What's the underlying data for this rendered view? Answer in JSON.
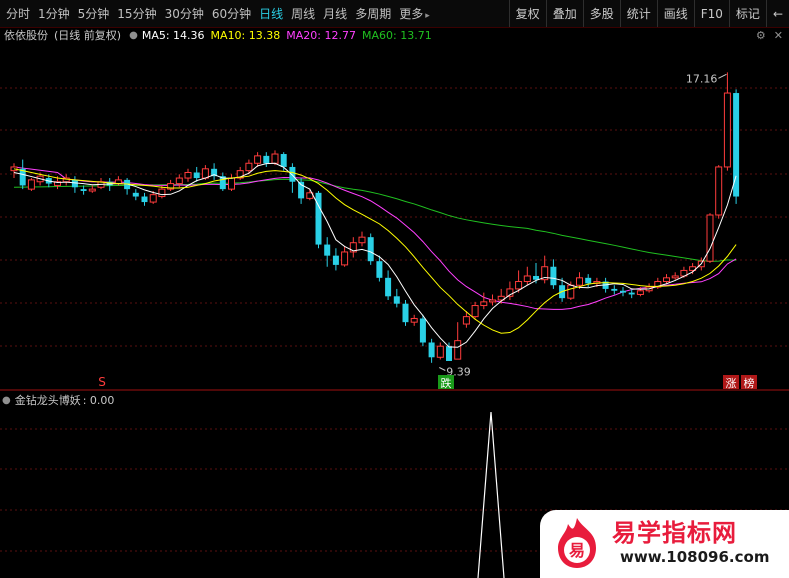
{
  "toolbar": {
    "periods": [
      "分时",
      "1分钟",
      "5分钟",
      "15分钟",
      "30分钟",
      "60分钟",
      "日线",
      "周线",
      "月线",
      "多周期",
      "更多"
    ],
    "active_period": 6,
    "more_arrow": "▸",
    "tools": [
      "复权",
      "叠加",
      "多股",
      "统计",
      "画线",
      "F10",
      "标记",
      "←"
    ]
  },
  "info": {
    "stock": "依依股份",
    "mode": "(日线 前复权)",
    "ma5": "MA5: 14.36",
    "ma10": "MA10: 13.38",
    "ma20": "MA20: 12.77",
    "ma60": "MA60: 13.71",
    "colors": {
      "ma5": "#ffffff",
      "ma10": "#ffff00",
      "ma20": "#ff40ff",
      "ma60": "#20c020"
    }
  },
  "window_icons": [
    "settings-icon",
    "close-icon"
  ],
  "indicator": {
    "name": "金钻龙头博妖",
    "value": ": 0.00"
  },
  "markers": {
    "s": "S",
    "die": "跌",
    "zhang": "涨",
    "bang": "榜"
  },
  "annotations": {
    "high": "17.16",
    "low": "9.39"
  },
  "logo": {
    "title": "易学指标网",
    "url": "www.108096.com",
    "char": "易"
  },
  "chart_data": {
    "type": "candlestick",
    "ylim": [
      8.7,
      17.9
    ],
    "candles": [
      [
        14.5,
        14.6,
        14.7,
        14.3
      ],
      [
        14.55,
        14.1,
        14.8,
        14.0
      ],
      [
        14.0,
        14.25,
        14.3,
        13.95
      ],
      [
        14.2,
        14.35,
        14.45,
        14.1
      ],
      [
        14.3,
        14.15,
        14.4,
        14.05
      ],
      [
        14.1,
        14.2,
        14.35,
        14.0
      ],
      [
        14.2,
        14.3,
        14.4,
        14.1
      ],
      [
        14.25,
        14.05,
        14.35,
        13.9
      ],
      [
        14.0,
        13.95,
        14.1,
        13.85
      ],
      [
        13.95,
        14.0,
        14.1,
        13.9
      ],
      [
        14.05,
        14.2,
        14.3,
        14.0
      ],
      [
        14.2,
        14.1,
        14.3,
        13.95
      ],
      [
        14.15,
        14.25,
        14.35,
        14.1
      ],
      [
        14.25,
        14.0,
        14.3,
        13.85
      ],
      [
        13.9,
        13.8,
        14.0,
        13.7
      ],
      [
        13.8,
        13.65,
        13.9,
        13.55
      ],
      [
        13.65,
        13.85,
        13.95,
        13.6
      ],
      [
        13.8,
        14.0,
        14.1,
        13.75
      ],
      [
        14.0,
        14.15,
        14.25,
        13.95
      ],
      [
        14.15,
        14.3,
        14.4,
        14.05
      ],
      [
        14.3,
        14.45,
        14.55,
        14.2
      ],
      [
        14.45,
        14.3,
        14.6,
        14.2
      ],
      [
        14.3,
        14.55,
        14.65,
        14.25
      ],
      [
        14.55,
        14.35,
        14.7,
        14.25
      ],
      [
        14.35,
        14.0,
        14.45,
        13.95
      ],
      [
        14.0,
        14.3,
        14.4,
        13.95
      ],
      [
        14.3,
        14.5,
        14.6,
        14.25
      ],
      [
        14.5,
        14.7,
        14.8,
        14.4
      ],
      [
        14.7,
        14.9,
        15.0,
        14.6
      ],
      [
        14.9,
        14.7,
        15.0,
        14.6
      ],
      [
        14.7,
        14.95,
        15.05,
        14.65
      ],
      [
        14.95,
        14.6,
        15.0,
        14.5
      ],
      [
        14.6,
        14.2,
        14.7,
        13.9
      ],
      [
        14.2,
        13.75,
        14.3,
        13.6
      ],
      [
        13.75,
        13.9,
        14.0,
        13.7
      ],
      [
        13.9,
        12.5,
        13.95,
        12.4
      ],
      [
        12.5,
        12.2,
        12.7,
        11.9
      ],
      [
        12.2,
        11.95,
        12.4,
        11.8
      ],
      [
        11.95,
        12.3,
        12.45,
        11.9
      ],
      [
        12.3,
        12.55,
        12.7,
        12.15
      ],
      [
        12.55,
        12.7,
        12.85,
        12.45
      ],
      [
        12.7,
        12.05,
        12.8,
        11.95
      ],
      [
        12.05,
        11.6,
        12.2,
        11.5
      ],
      [
        11.6,
        11.1,
        11.8,
        11.0
      ],
      [
        11.1,
        10.9,
        11.3,
        10.8
      ],
      [
        10.9,
        10.4,
        11.0,
        10.3
      ],
      [
        10.4,
        10.5,
        10.6,
        10.3
      ],
      [
        10.5,
        9.85,
        10.6,
        9.75
      ],
      [
        9.85,
        9.45,
        9.95,
        9.3
      ],
      [
        9.45,
        9.75,
        9.85,
        9.39
      ],
      [
        9.75,
        9.35,
        9.85,
        9.39
      ],
      [
        9.4,
        9.9,
        10.4,
        9.4
      ],
      [
        10.35,
        10.55,
        10.7,
        10.25
      ],
      [
        10.55,
        10.85,
        10.95,
        10.5
      ],
      [
        10.85,
        10.95,
        11.2,
        10.75
      ],
      [
        10.95,
        11.0,
        11.15,
        10.85
      ],
      [
        11.0,
        11.1,
        11.3,
        10.9
      ],
      [
        11.1,
        11.3,
        11.5,
        11.0
      ],
      [
        11.3,
        11.5,
        11.8,
        11.2
      ],
      [
        11.5,
        11.65,
        11.9,
        11.4
      ],
      [
        11.65,
        11.55,
        12.0,
        11.45
      ],
      [
        11.55,
        11.9,
        12.2,
        11.45
      ],
      [
        11.9,
        11.4,
        12.1,
        11.3
      ],
      [
        11.4,
        11.05,
        11.6,
        10.95
      ],
      [
        11.05,
        11.4,
        11.5,
        11.0
      ],
      [
        11.4,
        11.6,
        11.75,
        11.3
      ],
      [
        11.6,
        11.45,
        11.7,
        11.35
      ],
      [
        11.45,
        11.5,
        11.6,
        11.35
      ],
      [
        11.5,
        11.3,
        11.6,
        11.2
      ],
      [
        11.3,
        11.25,
        11.4,
        11.15
      ],
      [
        11.25,
        11.2,
        11.35,
        11.1
      ],
      [
        11.2,
        11.15,
        11.3,
        11.05
      ],
      [
        11.15,
        11.25,
        11.35,
        11.1
      ],
      [
        11.25,
        11.35,
        11.45,
        11.2
      ],
      [
        11.35,
        11.5,
        11.6,
        11.3
      ],
      [
        11.5,
        11.6,
        11.7,
        11.45
      ],
      [
        11.6,
        11.65,
        11.75,
        11.55
      ],
      [
        11.65,
        11.8,
        11.9,
        11.6
      ],
      [
        11.8,
        11.9,
        12.0,
        11.7
      ],
      [
        11.9,
        12.05,
        12.15,
        11.8
      ],
      [
        12.05,
        13.3,
        13.35,
        12.0
      ],
      [
        13.3,
        14.6,
        14.65,
        13.2
      ],
      [
        14.6,
        16.6,
        17.16,
        14.5
      ],
      [
        16.6,
        13.8,
        16.7,
        13.6
      ]
    ],
    "ma5": [
      14.45,
      14.4,
      14.34,
      14.28,
      14.22,
      14.18,
      14.19,
      14.17,
      14.15,
      14.12,
      14.13,
      14.14,
      14.15,
      14.14,
      14.07,
      13.98,
      13.91,
      13.85,
      13.86,
      13.95,
      14.1,
      14.23,
      14.3,
      14.39,
      14.3,
      14.29,
      14.33,
      14.43,
      14.63,
      14.69,
      14.7,
      14.59,
      14.38,
      14.12,
      14.0,
      13.55,
      13.12,
      12.63,
      12.45,
      12.33,
      12.37,
      12.3,
      12.17,
      11.96,
      11.63,
      11.24,
      10.87,
      10.58,
      10.25,
      9.97,
      9.73,
      9.72,
      9.86,
      10.16,
      10.49,
      10.77,
      10.97,
      11.14,
      11.26,
      11.4,
      11.53,
      11.61,
      11.59,
      11.53,
      11.4,
      11.34,
      11.33,
      11.39,
      11.41,
      11.44,
      11.42,
      11.3,
      11.29,
      11.3,
      11.37,
      11.44,
      11.53,
      11.64,
      11.76,
      11.98,
      12.39,
      12.96,
      13.57,
      14.36
    ],
    "ma10": [
      14.55,
      14.5,
      14.45,
      14.4,
      14.35,
      14.3,
      14.27,
      14.25,
      14.23,
      14.21,
      14.19,
      14.17,
      14.15,
      14.14,
      14.12,
      14.1,
      14.08,
      14.05,
      14.03,
      14.03,
      14.05,
      14.1,
      14.15,
      14.22,
      14.26,
      14.3,
      14.32,
      14.35,
      14.43,
      14.48,
      14.5,
      14.48,
      14.45,
      14.38,
      14.28,
      14.15,
      13.97,
      13.76,
      13.58,
      13.44,
      13.32,
      13.19,
      13.06,
      12.88,
      12.67,
      12.44,
      12.17,
      11.88,
      11.61,
      11.34,
      11.12,
      10.88,
      10.68,
      10.48,
      10.32,
      10.19,
      10.1,
      10.12,
      10.25,
      10.46,
      10.7,
      10.93,
      11.11,
      11.23,
      11.3,
      11.36,
      11.43,
      11.46,
      11.47,
      11.46,
      11.45,
      11.42,
      11.39,
      11.37,
      11.37,
      11.38,
      11.4,
      11.44,
      11.5,
      11.59,
      11.72,
      11.92,
      12.18,
      12.5
    ]
  }
}
